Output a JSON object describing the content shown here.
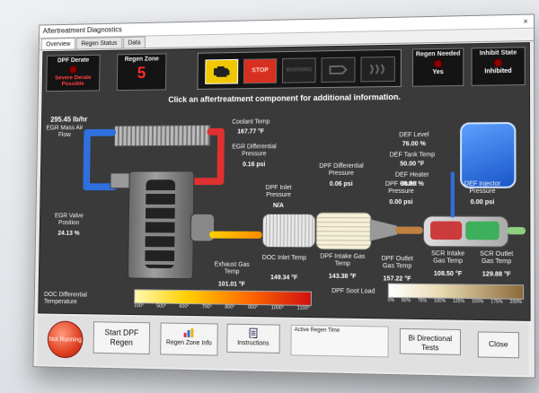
{
  "window": {
    "title": "Aftertreatment Diagnostics",
    "close": "×"
  },
  "tabs": [
    "Overview",
    "Regen Status",
    "Data"
  ],
  "status": {
    "dpf_derate": {
      "title": "DPF Derate",
      "value": "Severe Derate Possible"
    },
    "regen_zone": {
      "title": "Regen Zone",
      "value": "5"
    },
    "regen_needed": {
      "title": "Regen Needed",
      "value": "Yes"
    },
    "inhibit_state": {
      "title": "Inhibit State",
      "value": "Inhibited"
    }
  },
  "lamps": {
    "stop": "STOP",
    "warning": "WARNING"
  },
  "banner": "Click an aftertreatment component for additional information.",
  "readings": {
    "maf_value": "295.45 lb/hr",
    "maf_label": "EGR Mass Air Flow",
    "coolant_label": "Coolant Temp",
    "coolant_value": "167.77 °F",
    "egr_dp_label": "EGR Differential Pressure",
    "egr_dp_value": "0.16 psi",
    "egr_valve_label": "EGR Valve Position",
    "egr_valve_value": "24.13 %",
    "exhaust_label": "Exhaust Gas Temp",
    "exhaust_value": "101.01 °F",
    "dpf_inlet_p_label": "DPF Inlet Pressure",
    "dpf_inlet_p_value": "N/A",
    "doc_inlet_label": "DOC Inlet Temp",
    "doc_inlet_value": "149.34 °F",
    "dpf_diff_label": "DPF Differential Pressure",
    "dpf_diff_value": "0.06 psi",
    "dpf_intake_label": "DPF Intake Gas Temp",
    "dpf_intake_value": "143.38 °F",
    "dpf_outlet_p_label": "DPF Outlet Pressure",
    "dpf_outlet_p_value": "0.00 psi",
    "dpf_outlet_t_label": "DPF Outlet Gas Temp",
    "dpf_outlet_t_value": "157.22 °F",
    "def_level_label": "DEF Level",
    "def_level_value": "76.00 %",
    "def_tank_label": "DEF Tank Temp",
    "def_tank_value": "50.00 °F",
    "def_heater_label": "DEF Heater",
    "def_heater_value": "98.80 %",
    "def_injector_label": "DEF Injector Pressure",
    "def_injector_value": "0.00 psi",
    "scr_intake_label": "SCR Intake Gas Temp",
    "scr_intake_value": "108.50 °F",
    "scr_outlet_label": "SCR Outlet Gas Temp",
    "scr_outlet_value": "129.88 °F"
  },
  "soot": {
    "label": "DPF Soot Load",
    "ticks": [
      "0%",
      "50%",
      "75%",
      "100%",
      "125%",
      "150%",
      "175%",
      "200%"
    ]
  },
  "doc_temp": {
    "label": "DOC Differential Temperature",
    "ticks": [
      "100°",
      "500°",
      "600°",
      "700°",
      "800°",
      "900°",
      "1000°",
      "1100°"
    ]
  },
  "buttons": {
    "not_running": "Not Running",
    "start_regen": "Start DPF Regen",
    "regen_zone_info": "Regen Zone Info",
    "instructions": "Instructions",
    "active_regen_time": "Active Regen Time",
    "bidirectional": "Bi Directional Tests",
    "close": "Close"
  },
  "colors": {
    "panel": "#3a3a3a",
    "alert_red": "#ff3030",
    "egr_blue": "#2f6fe0",
    "egr_red": "#e03030",
    "amber": "#f0b400"
  }
}
